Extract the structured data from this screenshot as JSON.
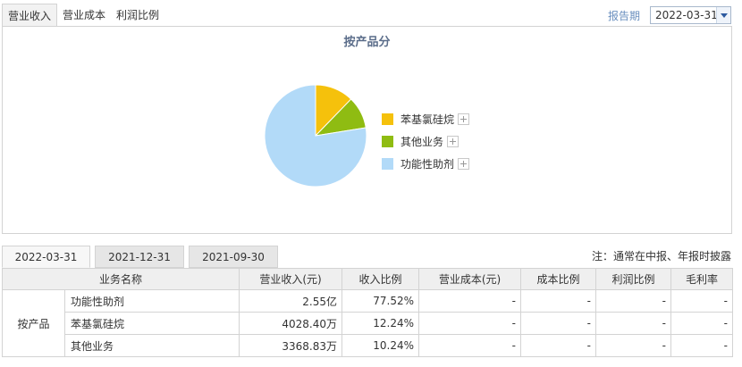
{
  "tabs": [
    "营业收入",
    "营业成本",
    "利润比例"
  ],
  "report_label": "报告期",
  "report_date": "2022-03-31",
  "chart_title": "按产品分",
  "chart_data": {
    "type": "pie",
    "title": "按产品分",
    "legend_position": "right",
    "slices": [
      {
        "name": "苯基氯硅烷",
        "value": 12.24,
        "color": "#f5c10c"
      },
      {
        "name": "其他业务",
        "value": 10.24,
        "color": "#8fbc12"
      },
      {
        "name": "功能性助剂",
        "value": 77.52,
        "color": "#b2daf8"
      }
    ]
  },
  "periods": [
    "2022-03-31",
    "2021-12-31",
    "2021-09-30"
  ],
  "note": "注：通常在中报、年报时披露",
  "table": {
    "headers": [
      "业务名称",
      "营业收入(元)",
      "收入比例",
      "营业成本(元)",
      "成本比例",
      "利润比例",
      "毛利率"
    ],
    "group": "按产品",
    "rows": [
      {
        "name": "功能性助剂",
        "revenue": "2.55亿",
        "ratio": "77.52%",
        "cost": "-",
        "cost_ratio": "-",
        "profit_ratio": "-",
        "margin": "-"
      },
      {
        "name": "苯基氯硅烷",
        "revenue": "4028.40万",
        "ratio": "12.24%",
        "cost": "-",
        "cost_ratio": "-",
        "profit_ratio": "-",
        "margin": "-"
      },
      {
        "name": "其他业务",
        "revenue": "3368.83万",
        "ratio": "10.24%",
        "cost": "-",
        "cost_ratio": "-",
        "profit_ratio": "-",
        "margin": "-"
      }
    ]
  }
}
